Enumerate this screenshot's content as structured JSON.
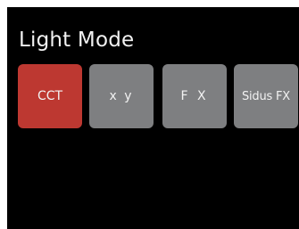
{
  "header": {
    "title": "Light Mode"
  },
  "modes": [
    {
      "label": "CCT",
      "selected": true
    },
    {
      "label": "x y",
      "selected": false
    },
    {
      "label": "F X",
      "selected": false
    },
    {
      "label": "Sidus FX",
      "selected": false
    }
  ],
  "colors": {
    "background": "#000000",
    "active_button": "#bd3831",
    "inactive_button": "#7e7f81",
    "text": "#f2f2f2"
  }
}
